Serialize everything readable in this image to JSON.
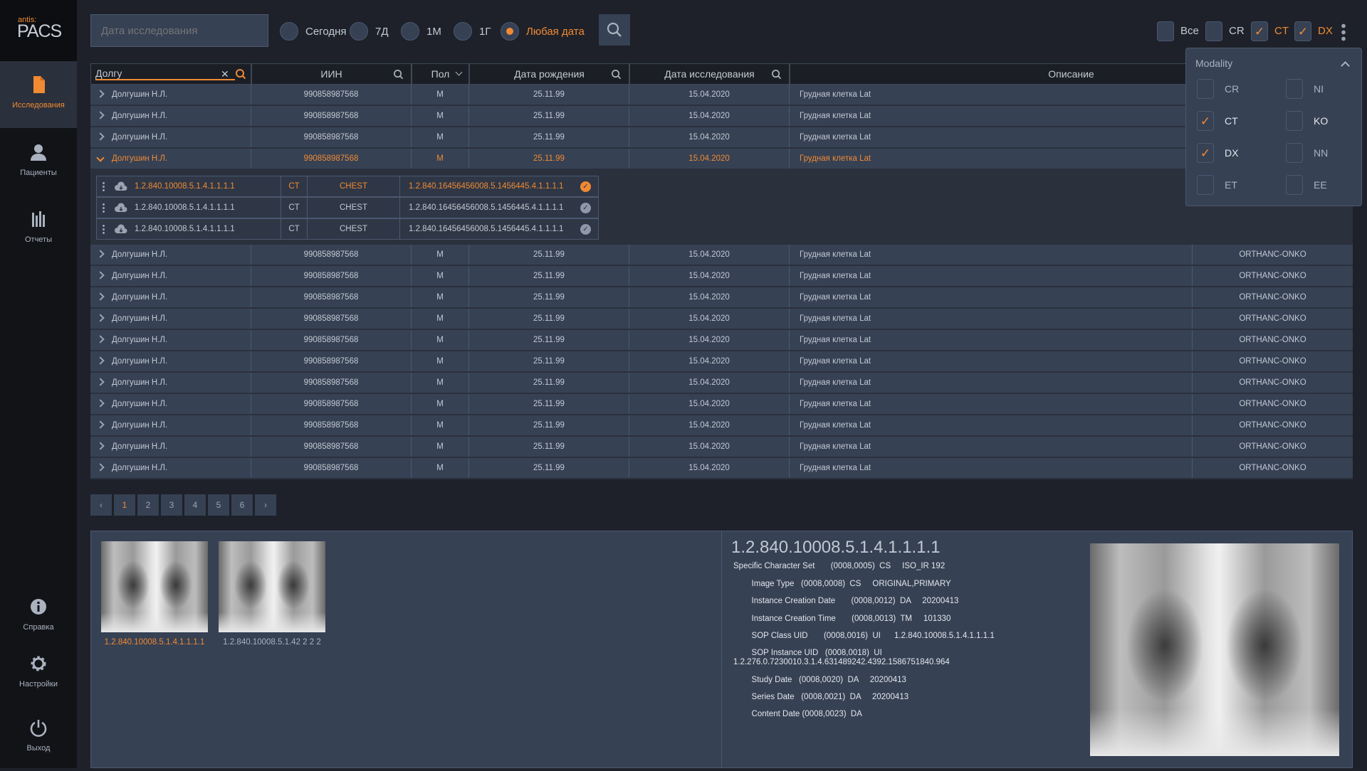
{
  "app": {
    "brand_small": "antis:",
    "brand": "PACS"
  },
  "sidebar": {
    "items": [
      {
        "label": "Исследования",
        "icon": "document-icon",
        "active": true
      },
      {
        "label": "Пациенты",
        "icon": "user-icon"
      },
      {
        "label": "Отчеты",
        "icon": "bars-icon"
      },
      {
        "label": "Справка",
        "icon": "info-icon"
      },
      {
        "label": "Настройки",
        "icon": "gear-icon"
      },
      {
        "label": "Выход",
        "icon": "power-icon"
      }
    ]
  },
  "filters": {
    "date_placeholder": "Дата исследования",
    "periods": [
      {
        "label": "Сегодня"
      },
      {
        "label": "7Д"
      },
      {
        "label": "1М"
      },
      {
        "label": "1Г"
      },
      {
        "label": "Любая дата",
        "selected": true
      }
    ],
    "modalities": [
      {
        "label": "Все",
        "checked": false
      },
      {
        "label": "CR",
        "checked": false
      },
      {
        "label": "CT",
        "checked": true
      },
      {
        "label": "DX",
        "checked": true
      }
    ]
  },
  "table": {
    "name_filter": "Долгу",
    "headers": [
      "ИИН",
      "Пол",
      "Дата рождения",
      "Дата исследования",
      "Описание"
    ],
    "rows_top": [
      {
        "name": "Долгушин Н.Л.",
        "iin": "990858987568",
        "sex": "M",
        "dob": "25.11.99",
        "date": "15.04.2020",
        "desc": "Грудная клетка Lat",
        "server": ""
      },
      {
        "name": "Долгушин Н.Л.",
        "iin": "990858987568",
        "sex": "M",
        "dob": "25.11.99",
        "date": "15.04.2020",
        "desc": "Грудная клетка Lat",
        "server": ""
      },
      {
        "name": "Долгушин Н.Л.",
        "iin": "990858987568",
        "sex": "M",
        "dob": "25.11.99",
        "date": "15.04.2020",
        "desc": "Грудная клетка Lat",
        "server": ""
      },
      {
        "name": "Долгушин Н.Л.",
        "iin": "990858987568",
        "sex": "M",
        "dob": "25.11.99",
        "date": "15.04.2020",
        "desc": "Грудная клетка Lat",
        "server": "",
        "expanded": true
      }
    ],
    "series": [
      {
        "uid": "1.2.840.10008.5.1.4.1.1.1.1",
        "modality": "CT",
        "body": "CHEST",
        "instance": "1.2.840.16456456008.5.1456445.4.1.1.1.1",
        "selected": true
      },
      {
        "uid": "1.2.840.10008.5.1.4.1.1.1.1",
        "modality": "CT",
        "body": "CHEST",
        "instance": "1.2.840.16456456008.5.1456445.4.1.1.1.1"
      },
      {
        "uid": "1.2.840.10008.5.1.4.1.1.1.1",
        "modality": "CT",
        "body": "CHEST",
        "instance": "1.2.840.16456456008.5.1456445.4.1.1.1.1"
      }
    ],
    "rows_bottom": [
      {
        "name": "Долгушин Н.Л.",
        "iin": "990858987568",
        "sex": "M",
        "dob": "25.11.99",
        "date": "15.04.2020",
        "desc": "Грудная клетка Lat",
        "server": "ORTHANC-ONKO"
      },
      {
        "name": "Долгушин Н.Л.",
        "iin": "990858987568",
        "sex": "M",
        "dob": "25.11.99",
        "date": "15.04.2020",
        "desc": "Грудная клетка Lat",
        "server": "ORTHANC-ONKO"
      },
      {
        "name": "Долгушин Н.Л.",
        "iin": "990858987568",
        "sex": "M",
        "dob": "25.11.99",
        "date": "15.04.2020",
        "desc": "Грудная клетка Lat",
        "server": "ORTHANC-ONKO"
      },
      {
        "name": "Долгушин Н.Л.",
        "iin": "990858987568",
        "sex": "M",
        "dob": "25.11.99",
        "date": "15.04.2020",
        "desc": "Грудная клетка Lat",
        "server": "ORTHANC-ONKO"
      },
      {
        "name": "Долгушин Н.Л.",
        "iin": "990858987568",
        "sex": "M",
        "dob": "25.11.99",
        "date": "15.04.2020",
        "desc": "Грудная клетка Lat",
        "server": "ORTHANC-ONKO"
      },
      {
        "name": "Долгушин Н.Л.",
        "iin": "990858987568",
        "sex": "M",
        "dob": "25.11.99",
        "date": "15.04.2020",
        "desc": "Грудная клетка Lat",
        "server": "ORTHANC-ONKO"
      },
      {
        "name": "Долгушин Н.Л.",
        "iin": "990858987568",
        "sex": "M",
        "dob": "25.11.99",
        "date": "15.04.2020",
        "desc": "Грудная клетка Lat",
        "server": "ORTHANC-ONKO"
      },
      {
        "name": "Долгушин Н.Л.",
        "iin": "990858987568",
        "sex": "M",
        "dob": "25.11.99",
        "date": "15.04.2020",
        "desc": "Грудная клетка Lat",
        "server": "ORTHANC-ONKO"
      },
      {
        "name": "Долгушин Н.Л.",
        "iin": "990858987568",
        "sex": "M",
        "dob": "25.11.99",
        "date": "15.04.2020",
        "desc": "Грудная клетка Lat",
        "server": "ORTHANC-ONKO"
      },
      {
        "name": "Долгушин Н.Л.",
        "iin": "990858987568",
        "sex": "M",
        "dob": "25.11.99",
        "date": "15.04.2020",
        "desc": "Грудная клетка Lat",
        "server": "ORTHANC-ONKO"
      },
      {
        "name": "Долгушин Н.Л.",
        "iin": "990858987568",
        "sex": "M",
        "dob": "25.11.99",
        "date": "15.04.2020",
        "desc": "Грудная клетка Lat",
        "server": "ORTHANC-ONKO"
      }
    ]
  },
  "pagination": {
    "pages": [
      "1",
      "2",
      "3",
      "4",
      "5",
      "6"
    ],
    "current": "1"
  },
  "thumbnails": [
    {
      "label": "1.2.840.10008.5.1.4.1.1.1.1",
      "selected": true
    },
    {
      "label": "1.2.840.10008.5.1.42 2 2 2"
    }
  ],
  "details": {
    "title": "1.2.840.10008.5.1.4.1.1.1.1",
    "lines": [
      "Specific Character Set       (0008,0005)  CS     ISO_IR 192",
      "        Image Type   (0008,0008)  CS     ORIGINAL,PRIMARY",
      "        Instance Creation Date       (0008,0012)  DA     20200413",
      "        Instance Creation Time       (0008,0013)  TM     101330",
      "        SOP Class UID       (0008,0016)  UI      1.2.840.10008.5.1.4.1.1.1.1",
      "        SOP Instance UID   (0008,0018)  UI\n1.2.276.0.7230010.3.1.4.631489242.4392.1586751840.964",
      "        Study Date   (0008,0020)  DA     20200413",
      "        Series Date   (0008,0021)  DA     20200413",
      "        Content Date (0008,0023)  DA"
    ]
  },
  "modality_dropdown": {
    "title": "Modality",
    "options": [
      {
        "label": "CR",
        "checked": false
      },
      {
        "label": "NI",
        "checked": false
      },
      {
        "label": "CT",
        "checked": true
      },
      {
        "label": "KO",
        "checked": false
      },
      {
        "label": "DX",
        "checked": true
      },
      {
        "label": "NN",
        "checked": false
      },
      {
        "label": "ET",
        "checked": false
      },
      {
        "label": "EE",
        "checked": false
      }
    ]
  },
  "colors": {
    "accent": "#f08a33",
    "panel": "#364154",
    "bg": "#1e2129"
  }
}
